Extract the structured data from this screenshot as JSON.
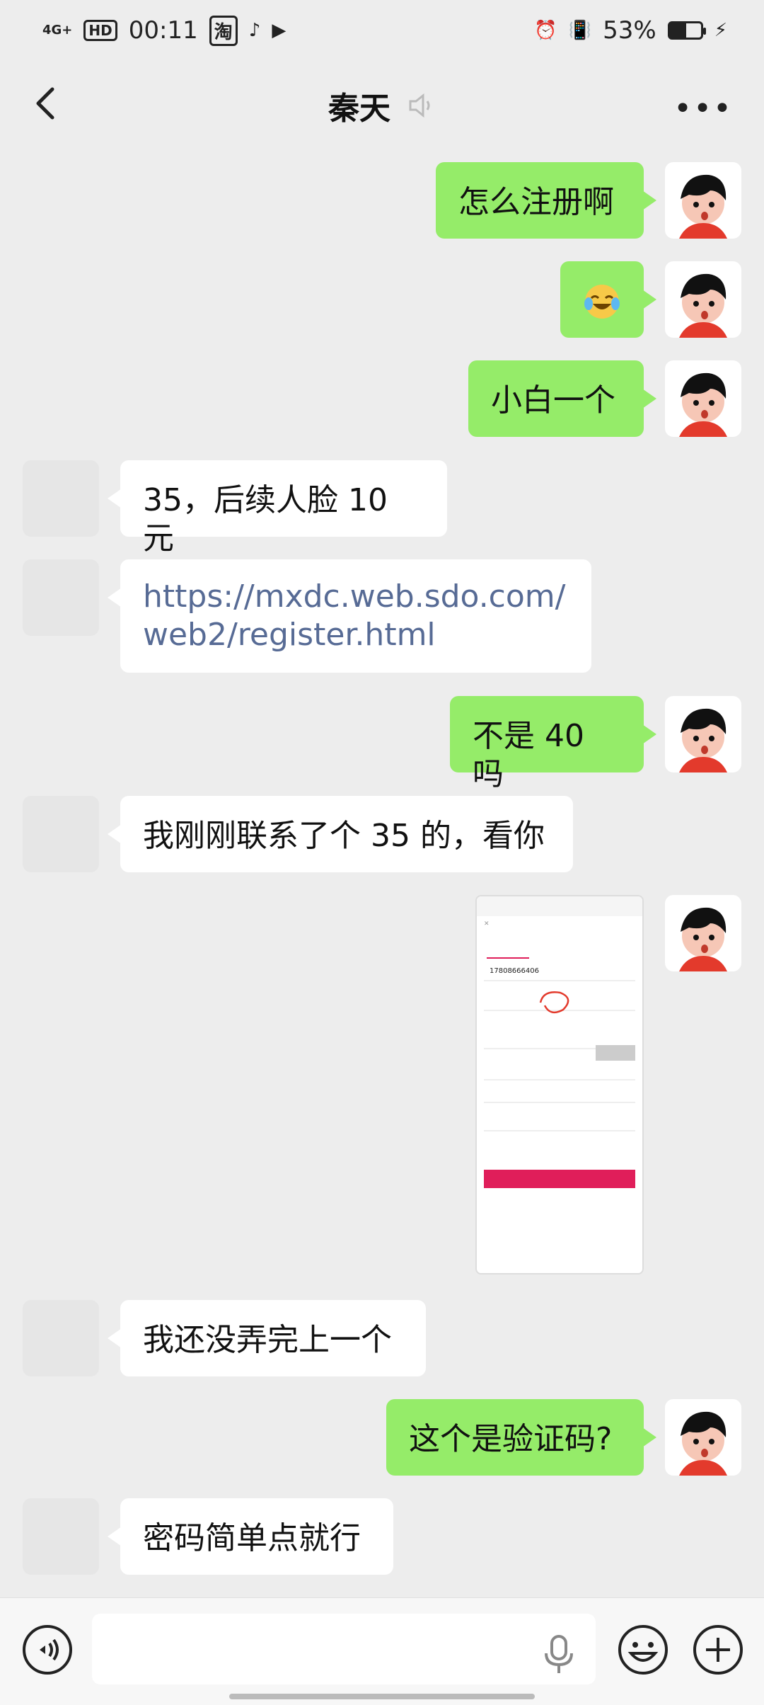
{
  "status_bar": {
    "network": "4G+",
    "hd": "HD",
    "time": "00:11",
    "taobao": "淘",
    "battery_percent": "53%",
    "battery_level": 0.53
  },
  "header": {
    "title": "秦天"
  },
  "messages": [
    {
      "side": "sent",
      "text": "怎么注册啊"
    },
    {
      "side": "sent",
      "type": "emoji",
      "icon": "crying-laughing-emoji"
    },
    {
      "side": "sent",
      "text": "小白一个"
    },
    {
      "side": "recv",
      "text": "35，后续人脸 10 元"
    },
    {
      "side": "recv",
      "text": "https://mxdc.web.sdo.com/web2/register.html"
    },
    {
      "side": "sent",
      "text": "不是 40 吗"
    },
    {
      "side": "recv",
      "text": "我刚刚联系了个 35 的，看你"
    },
    {
      "side": "sent",
      "type": "image",
      "icon": "screenshot-thumbnail"
    },
    {
      "side": "recv",
      "text": "我还没弄完上一个"
    },
    {
      "side": "sent",
      "text": "这个是验证码?"
    },
    {
      "side": "recv",
      "text": "密码简单点就行"
    }
  ],
  "thumbnail": {
    "phone": "17808666406"
  },
  "colors": {
    "sent_bubble": "#95ec69",
    "recv_bubble": "#ffffff",
    "background": "#ededed",
    "link": "#576b95"
  }
}
